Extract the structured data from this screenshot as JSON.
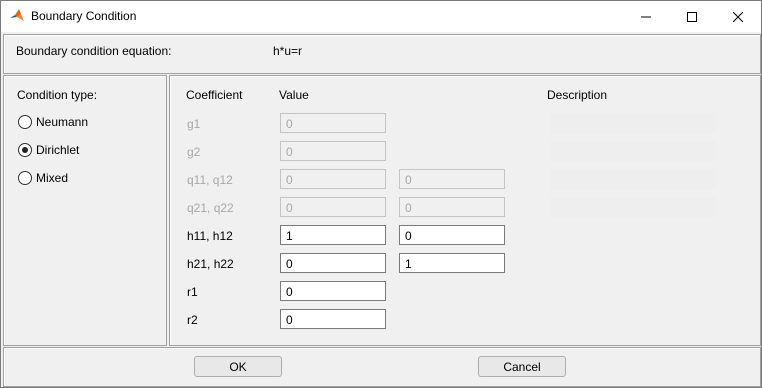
{
  "window": {
    "title": "Boundary Condition",
    "app_icon": "matlab-membrane-icon",
    "controls": [
      "minimize-icon",
      "maximize-icon",
      "close-icon"
    ]
  },
  "equation": {
    "label": "Boundary condition equation:",
    "value": "h*u=r"
  },
  "condition_type": {
    "label": "Condition type:",
    "options": [
      {
        "label": "Neumann",
        "selected": false
      },
      {
        "label": "Dirichlet",
        "selected": true
      },
      {
        "label": "Mixed",
        "selected": false
      }
    ]
  },
  "coefficients": {
    "headers": {
      "coefficient": "Coefficient",
      "value": "Value",
      "description": "Description"
    },
    "rows": [
      {
        "name": "g1",
        "values": [
          "0"
        ],
        "enabled": false
      },
      {
        "name": "g2",
        "values": [
          "0"
        ],
        "enabled": false
      },
      {
        "name": "q11, q12",
        "values": [
          "0",
          "0"
        ],
        "enabled": false
      },
      {
        "name": "q21, q22",
        "values": [
          "0",
          "0"
        ],
        "enabled": false
      },
      {
        "name": "h11, h12",
        "values": [
          "1",
          "0"
        ],
        "enabled": true
      },
      {
        "name": "h21, h22",
        "values": [
          "0",
          "1"
        ],
        "enabled": true
      },
      {
        "name": "r1",
        "values": [
          "0"
        ],
        "enabled": true
      },
      {
        "name": "r2",
        "values": [
          "0"
        ],
        "enabled": true
      }
    ]
  },
  "buttons": {
    "ok": "OK",
    "cancel": "Cancel"
  },
  "colors": {
    "dialog_background": "#f0f0f0",
    "disabled_text": "#a8a8a8",
    "matlab_orange": "#e8620c",
    "matlab_blue": "#1f5fa8"
  }
}
